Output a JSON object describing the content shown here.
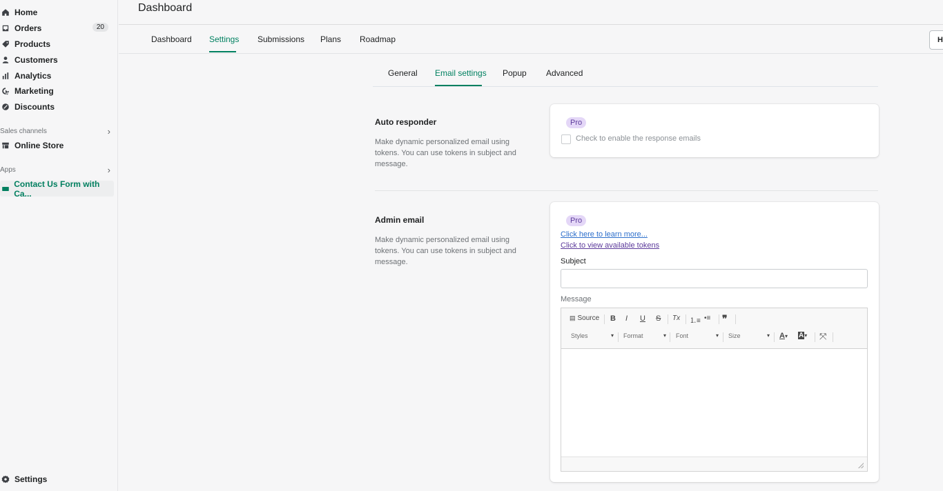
{
  "sidebar": {
    "items": [
      {
        "label": "Home",
        "icon": "home-icon"
      },
      {
        "label": "Orders",
        "icon": "orders-icon",
        "badge": "20"
      },
      {
        "label": "Products",
        "icon": "tag-icon"
      },
      {
        "label": "Customers",
        "icon": "person-icon"
      },
      {
        "label": "Analytics",
        "icon": "bar-chart-icon"
      },
      {
        "label": "Marketing",
        "icon": "marketing-icon"
      },
      {
        "label": "Discounts",
        "icon": "discount-icon"
      }
    ],
    "sales_channels_label": "Sales channels",
    "online_store_label": "Online Store",
    "apps_label": "Apps",
    "app_item_label": "Contact Us Form with Ca...",
    "settings_label": "Settings"
  },
  "header": {
    "title": "Dashboard",
    "help_label": "H"
  },
  "tabs": [
    "Dashboard",
    "Settings",
    "Submissions",
    "Plans",
    "Roadmap"
  ],
  "active_tab": "Settings",
  "subtabs": [
    "General",
    "Email settings",
    "Popup",
    "Advanced"
  ],
  "active_subtab": "Email settings",
  "auto_responder": {
    "title": "Auto responder",
    "description": "Make dynamic personalized email using tokens. You can use tokens in subject and message.",
    "pro_label": "Pro",
    "checkbox_label": "Check to enable the response emails",
    "checked": false
  },
  "admin_email": {
    "title": "Admin email",
    "description": "Make dynamic personalized email using tokens. You can use tokens in subject and message.",
    "pro_label": "Pro",
    "learn_more_link": "Click here to learn more...",
    "tokens_link": "Click to view available tokens",
    "subject_label": "Subject",
    "subject_value": "",
    "message_label": "Message"
  },
  "editor_toolbar": {
    "source_label": "Source",
    "bold": "B",
    "italic": "I",
    "underline": "U",
    "strike": "S",
    "remove_format": "Tx",
    "styles_label": "Styles",
    "format_label": "Format",
    "font_label": "Font",
    "size_label": "Size",
    "text_color": "A",
    "bg_color": "A"
  },
  "colors": {
    "accent": "#008060",
    "link": "#2c6ecb",
    "pro_badge_bg": "#e4d7f7"
  }
}
